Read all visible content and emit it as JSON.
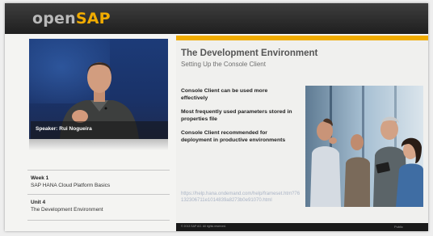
{
  "header": {
    "brand_open": "open",
    "brand_sap": "SAP"
  },
  "speaker": {
    "label": "Speaker: Rui Nogueira"
  },
  "course": {
    "week_label": "Week 1",
    "week_title": "SAP HANA Cloud Platform Basics",
    "unit_label": "Unit 4",
    "unit_title": "The Development Environment"
  },
  "slide": {
    "title": "The Development Environment",
    "subtitle": "Setting Up the Console Client",
    "bullets": [
      "Console Client can be used more effectively",
      "Most frequently used parameters stored in properties file",
      "Console Client recommended for deployment in productive environments"
    ],
    "link": "https://help.hana.ondemand.com/help/frameset.htm?76132306711e1014839a8273b0e91070.html",
    "footer_left": "© 2013 SAP AG. All rights reserved.",
    "footer_right": "Public"
  },
  "colors": {
    "accent": "#f0ab00",
    "header_bg": "#2b2b2b",
    "slide_bg": "#f0f0ee"
  },
  "icons": [
    "speaker-video",
    "team-photo"
  ]
}
